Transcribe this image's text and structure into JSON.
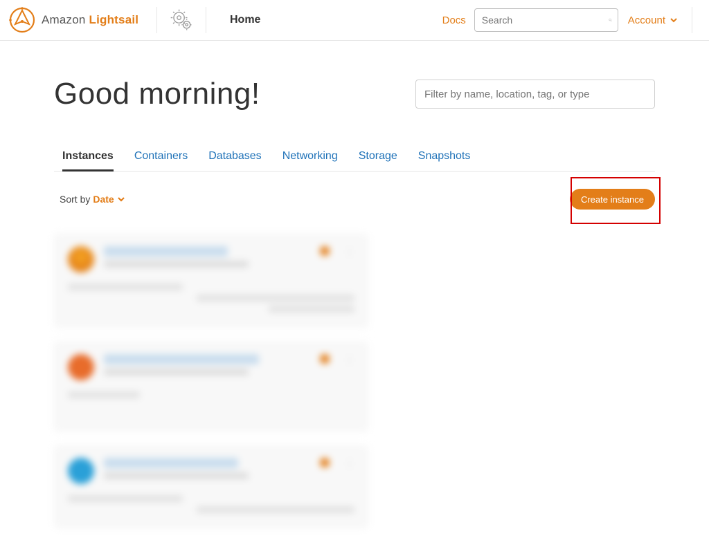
{
  "brand": {
    "left": "Amazon ",
    "right": "Lightsail"
  },
  "nav": {
    "home": "Home",
    "docs": "Docs",
    "account": "Account"
  },
  "search": {
    "placeholder": "Search"
  },
  "greeting": "Good morning!",
  "filter": {
    "placeholder": "Filter by name, location, tag, or type"
  },
  "tabs": {
    "instances": "Instances",
    "containers": "Containers",
    "databases": "Databases",
    "networking": "Networking",
    "storage": "Storage",
    "snapshots": "Snapshots"
  },
  "sort": {
    "label": "Sort by ",
    "field": "Date"
  },
  "actions": {
    "create": "Create instance"
  }
}
